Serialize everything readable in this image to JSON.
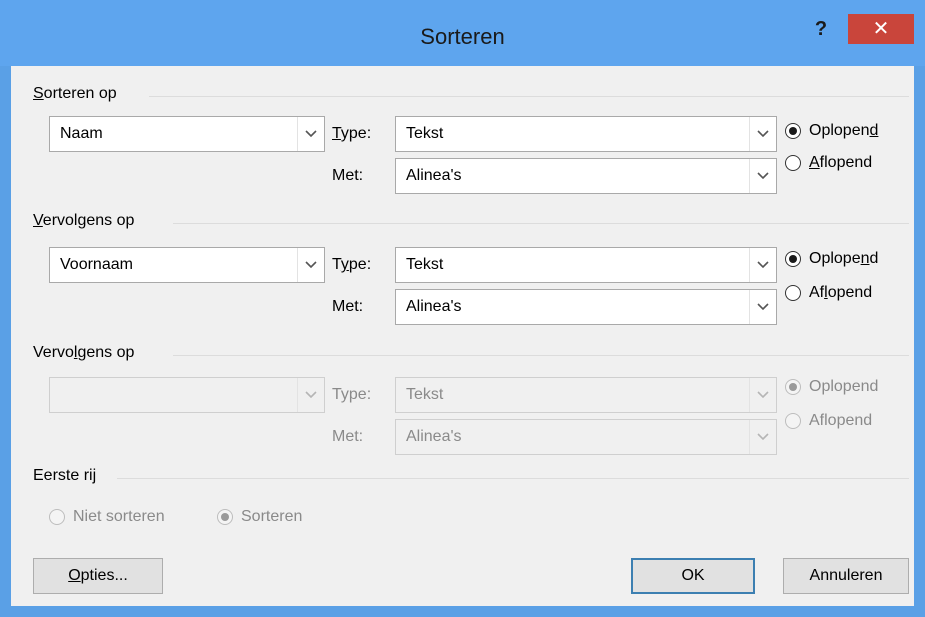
{
  "window": {
    "title": "Sorteren",
    "help_label": "?",
    "close_label": "✕"
  },
  "colors": {
    "titlebar": "#5ea5ee",
    "close": "#c9453b",
    "client": "#f0f0f0"
  },
  "group1": {
    "label": "Sorteren op",
    "field": "Naam",
    "type_label": "Type:",
    "type_value": "Tekst",
    "met_label": "Met:",
    "met_value": "Alinea's",
    "asc_label": "Oplopend",
    "desc_label": "Aflopend",
    "selected": "asc"
  },
  "group2": {
    "label": "Vervolgens op",
    "field": "Voornaam",
    "type_label": "Type:",
    "type_value": "Tekst",
    "met_label": "Met:",
    "met_value": "Alinea's",
    "asc_label": "Oplopend",
    "desc_label": "Aflopend",
    "selected": "asc"
  },
  "group3": {
    "label": "Vervolgens op",
    "field": "",
    "type_label": "Type:",
    "type_value": "Tekst",
    "met_label": "Met:",
    "met_value": "Alinea's",
    "asc_label": "Oplopend",
    "desc_label": "Aflopend",
    "selected": "asc",
    "disabled": true
  },
  "header_row": {
    "label": "Eerste rij",
    "no_sort_label": "Niet sorteren",
    "sort_label": "Sorteren",
    "selected": "sort",
    "disabled": true
  },
  "buttons": {
    "options": "Opties...",
    "ok": "OK",
    "cancel": "Annuleren"
  }
}
